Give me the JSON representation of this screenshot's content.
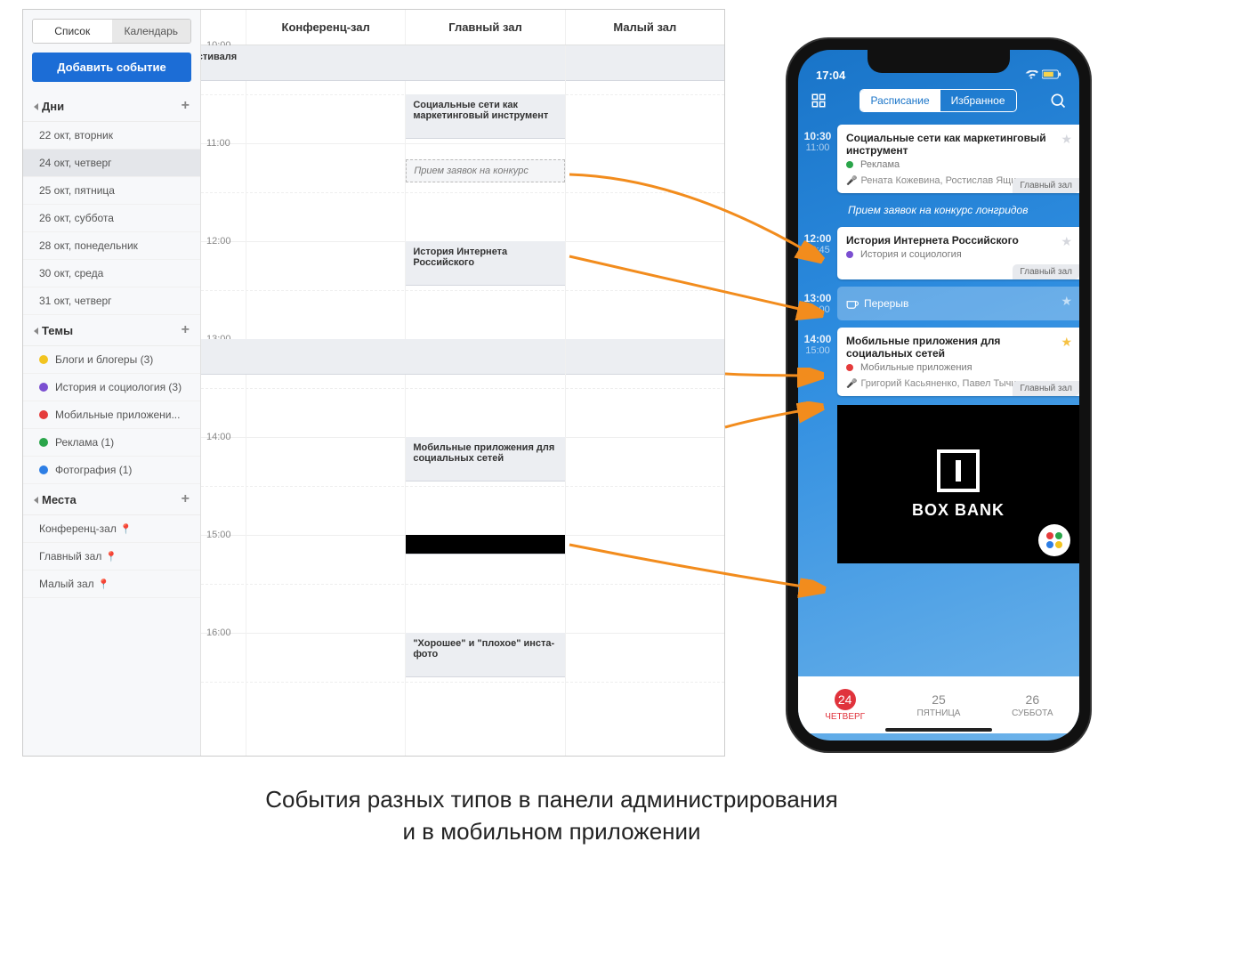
{
  "caption_line1": "События разных типов в панели администрирования",
  "caption_line2": "и в мобильном приложении",
  "admin": {
    "view_list": "Список",
    "view_calendar": "Календарь",
    "add_event": "Добавить событие",
    "sections": {
      "days": "Дни",
      "themes": "Темы",
      "places": "Места"
    },
    "days": [
      "22 окт, вторник",
      "24 окт, четверг",
      "25 окт, пятница",
      "26 окт, суббота",
      "28 окт, понедельник",
      "30 окт, среда",
      "31 окт, четверг"
    ],
    "themes": [
      {
        "label": "Блоги и блогеры (3)",
        "color": "#f2c420"
      },
      {
        "label": "История и социология (3)",
        "color": "#7b4fd1"
      },
      {
        "label": "Мобильные приложени...",
        "color": "#e53b3b"
      },
      {
        "label": "Реклама (1)",
        "color": "#2aa54a"
      },
      {
        "label": "Фотография (1)",
        "color": "#2d7ee5"
      }
    ],
    "places": [
      "Конференц-зал",
      "Главный зал",
      "Малый зал"
    ],
    "rooms": [
      "Конференц-зал",
      "Главный зал",
      "Малый зал"
    ],
    "hours": [
      "10:00",
      "11:00",
      "12:00",
      "13:00",
      "14:00",
      "15:00",
      "16:00"
    ],
    "events": {
      "opening": "Открытие фестиваля",
      "social": "Социальные сети как маркетинговый инструмент",
      "contest": "Прием заявок на конкурс",
      "history": "История Интернета Российского",
      "break": "Перерыв",
      "mobile": "Мобильные приложения для социальных сетей",
      "insta": "\"Хорошее\" и \"плохое\" инста-фото"
    }
  },
  "phone": {
    "time": "17:04",
    "seg_schedule": "Расписание",
    "seg_favorites": "Избранное",
    "cards": {
      "c1": {
        "t1": "10:30",
        "t2": "11:00",
        "title": "Социальные сети как маркетинговый инструмент",
        "tag": "Реклама",
        "tag_color": "#2aa54a",
        "speakers": "Рената Кожевина, Ростислав Ящин",
        "room": "Главный зал"
      },
      "global": "Прием заявок на конкурс лонгридов",
      "c2": {
        "t1": "12:00",
        "t2": "12:45",
        "title": "История Интернета Российского",
        "tag": "История и социология",
        "tag_color": "#7b4fd1",
        "room": "Главный зал"
      },
      "break": {
        "t1": "13:00",
        "t2": "14:00",
        "title": "Перерыв"
      },
      "c3": {
        "t1": "14:00",
        "t2": "15:00",
        "title": "Мобильные приложения для социальных сетей",
        "tag": "Мобильные приложения",
        "tag_color": "#e53b3b",
        "speakers": "Григорий Касьяненко, Павел Тычинин",
        "room": "Главный зал"
      }
    },
    "banner": "BOX BANK",
    "day_tabs": [
      {
        "num": "24",
        "name": "ЧЕТВЕРГ"
      },
      {
        "num": "25",
        "name": "ПЯТНИЦА"
      },
      {
        "num": "26",
        "name": "СУББОТА"
      }
    ]
  }
}
